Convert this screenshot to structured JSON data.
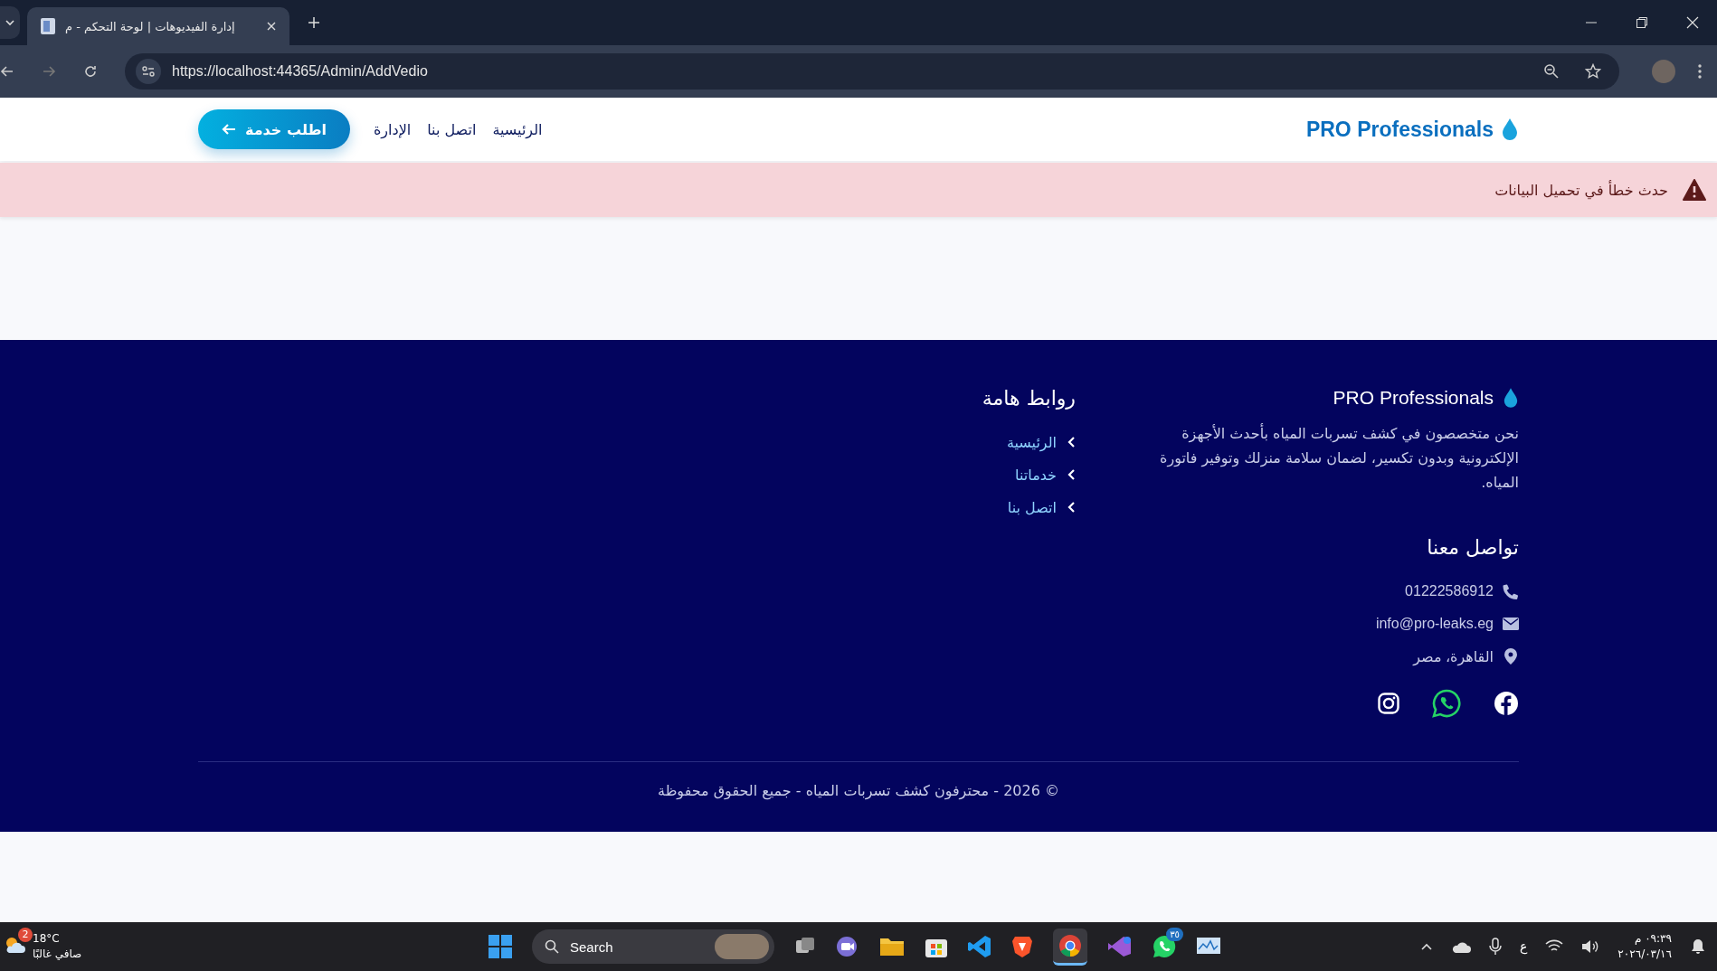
{
  "browser": {
    "tab_title": "إدارة الفيديوهات | لوحة التحكم - م",
    "url": "https://localhost:44365/Admin/AddVedio"
  },
  "navbar": {
    "brand": "PRO Professionals",
    "links": [
      {
        "label": "الرئيسية"
      },
      {
        "label": "اتصل بنا"
      },
      {
        "label": "الإدارة"
      }
    ],
    "cta": "اطلب خدمة"
  },
  "alert": {
    "message": "حدث خطأ في تحميل البيانات"
  },
  "footer": {
    "brand": "PRO Professionals",
    "about": "نحن متخصصون في كشف تسربات المياه بأحدث الأجهزة الإلكترونية وبدون تكسير، لضمان سلامة منزلك وتوفير فاتورة المياه.",
    "links_title": "روابط هامة",
    "links": [
      "الرئيسية",
      "خدماتنا",
      "اتصل بنا"
    ],
    "contact_title": "تواصل معنا",
    "contacts": [
      {
        "kind": "phone",
        "text": "01222586912"
      },
      {
        "kind": "email",
        "text": "info@pro-leaks.eg"
      },
      {
        "kind": "location",
        "text": "القاهرة، مصر"
      }
    ],
    "copyright": "© 2026 - محترفون كشف تسربات المياه - جميع الحقوق محفوظة"
  },
  "taskbar": {
    "weather_badge": "2",
    "temperature": "18°C",
    "weather": "صافي غالبًا",
    "search": "Search",
    "whatsapp_badge": "٣٥",
    "language": "ع",
    "time": "٠٩:٣٩ م",
    "date": "٢٠٢٦/٠٣/١٦"
  }
}
